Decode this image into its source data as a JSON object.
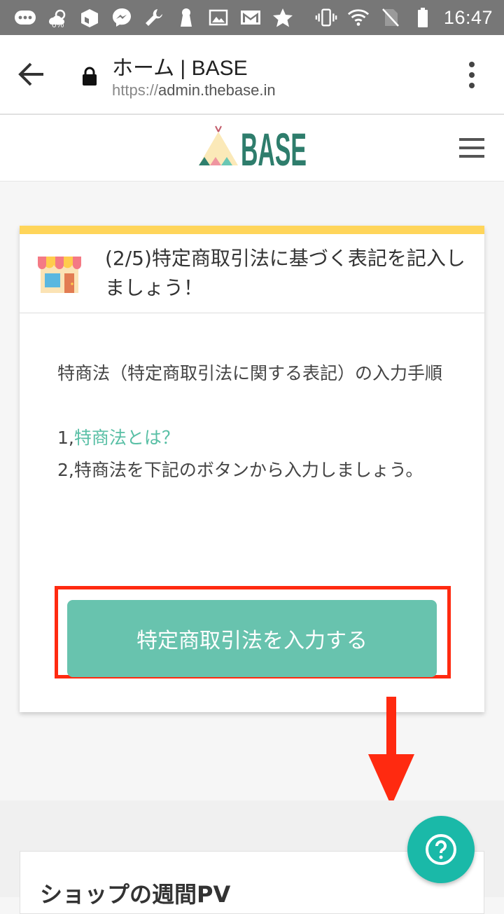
{
  "status_bar": {
    "battery_saver_pct": "0%",
    "time": "16:47",
    "icons": [
      "chat-bubble-icon",
      "weather-icon",
      "box-icon",
      "messenger-icon",
      "wrench-icon",
      "keyhole-icon",
      "image-icon",
      "gmail-icon",
      "star-icon",
      "vibrate-icon",
      "wifi-icon",
      "no-sim-icon",
      "battery-icon"
    ]
  },
  "browser": {
    "title": "ホーム | BASE",
    "url_protocol": "https://",
    "url_host": "admin.thebase.in"
  },
  "site": {
    "logo_text": "BASE"
  },
  "card": {
    "title": "(2/5)特定商取引法に基づく表記を記入しましょう！",
    "intro": "特商法（特定商取引法に関する表記）の入力手順",
    "step1_prefix": "1,",
    "step1_link": "特商法とは？",
    "step2": "2,特商法を下記のボタンから入力しましょう。",
    "cta_label": "特定商取引法を入力する"
  },
  "colors": {
    "accent": "#68c3ae",
    "highlight": "#ff2a10",
    "card_top": "#ffd55a",
    "help": "#1ab9a8"
  },
  "bottom": {
    "pv_title": "ショップの週間PV"
  }
}
